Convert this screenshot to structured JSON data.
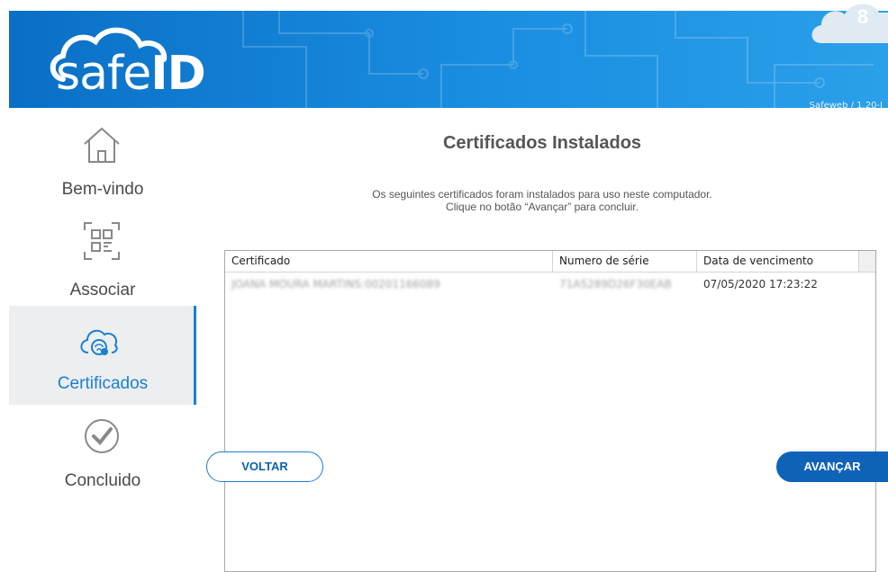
{
  "header": {
    "logo_text_light": "safe",
    "logo_text_bold": "ID",
    "version": "Safeweb / 1.20-I",
    "badge": "8"
  },
  "sidebar": {
    "items": [
      {
        "label": "Bem-vindo",
        "icon": "home-icon",
        "active": false
      },
      {
        "label": "Associar",
        "icon": "qr-code-icon",
        "active": false
      },
      {
        "label": "Certificados",
        "icon": "cloud-fingerprint-icon",
        "active": true
      },
      {
        "label": "Concluido",
        "icon": "check-circle-icon",
        "active": false
      }
    ]
  },
  "main": {
    "title": "Certificados Instalados",
    "description_line1": "Os seguintes certificados foram instalados para uso neste computador.",
    "description_line2": "Clique no botão “Avançar” para concluir.",
    "table": {
      "columns": [
        "Certificado",
        "Numero de série",
        "Data de vencimento"
      ],
      "rows": [
        {
          "certificado": "JOANA MOURA MARTINS:00201166089",
          "serie": "71A5289D26F30EAB",
          "vencimento": "07/05/2020 17:23:22"
        }
      ]
    },
    "buttons": {
      "back": "VOLTAR",
      "next": "AVANÇAR"
    }
  },
  "colors": {
    "accent": "#1a7fd4",
    "header": "#1a8ee0",
    "primary_button": "#0e63b8"
  }
}
